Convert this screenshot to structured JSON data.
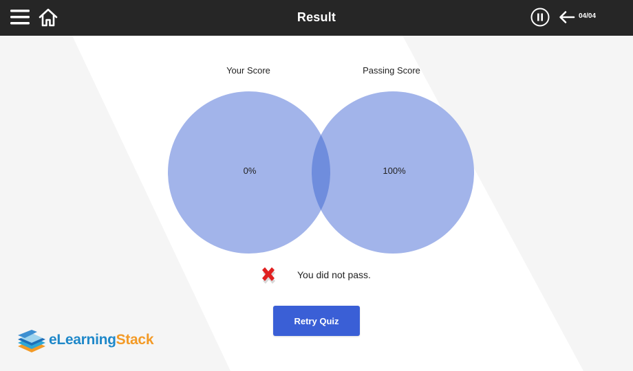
{
  "header": {
    "title": "Result",
    "page_counter": "04/04",
    "icons": {
      "menu": "hamburger-menu-icon",
      "home": "home-icon",
      "pause": "pause-icon",
      "back": "arrow-left-icon"
    }
  },
  "scores": {
    "your_score_label": "Your Score",
    "your_score_value": "0%",
    "passing_score_label": "Passing Score",
    "passing_score_value": "100%"
  },
  "result": {
    "icon": "red-x-icon",
    "message": "You did not pass."
  },
  "actions": {
    "retry_label": "Retry Quiz"
  },
  "logo": {
    "part_a": "eLearning",
    "part_b": "Stack"
  },
  "colors": {
    "topbar": "#262626",
    "circle_fill": "#a2b4ea",
    "circle_overlap": "#6f8ddd",
    "button": "#3a5fd6",
    "fail_red": "#e02020",
    "logo_blue": "#1f88c9",
    "logo_orange": "#f39a26"
  }
}
